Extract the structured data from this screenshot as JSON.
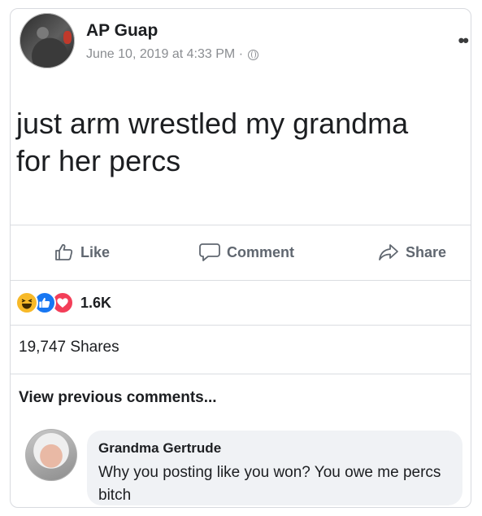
{
  "post": {
    "author": "AP Guap",
    "timestamp": "June 10, 2019 at 4:33 PM ·",
    "privacy_icon": "globe-icon",
    "more_icon": "••",
    "text_line1": "just arm wrestled my grandma",
    "text_line2": "for her percs"
  },
  "actions": {
    "like_label": "Like",
    "comment_label": "Comment",
    "share_label": "Share"
  },
  "reactions": {
    "icons": [
      "haha-reaction-icon",
      "like-reaction-icon",
      "love-reaction-icon"
    ],
    "count": "1.6K"
  },
  "shares": {
    "text": "19,747 Shares"
  },
  "comments": {
    "view_previous": "View previous comments...",
    "items": [
      {
        "author": "Grandma Gertrude",
        "text": "Why you posting like you won? You owe me percs bitch"
      }
    ]
  },
  "colors": {
    "muted_text": "#606770",
    "like_blue": "#1877f2",
    "love_red": "#f33e58",
    "haha_yellow": "#f7b928",
    "bubble_bg": "#f0f2f5"
  }
}
